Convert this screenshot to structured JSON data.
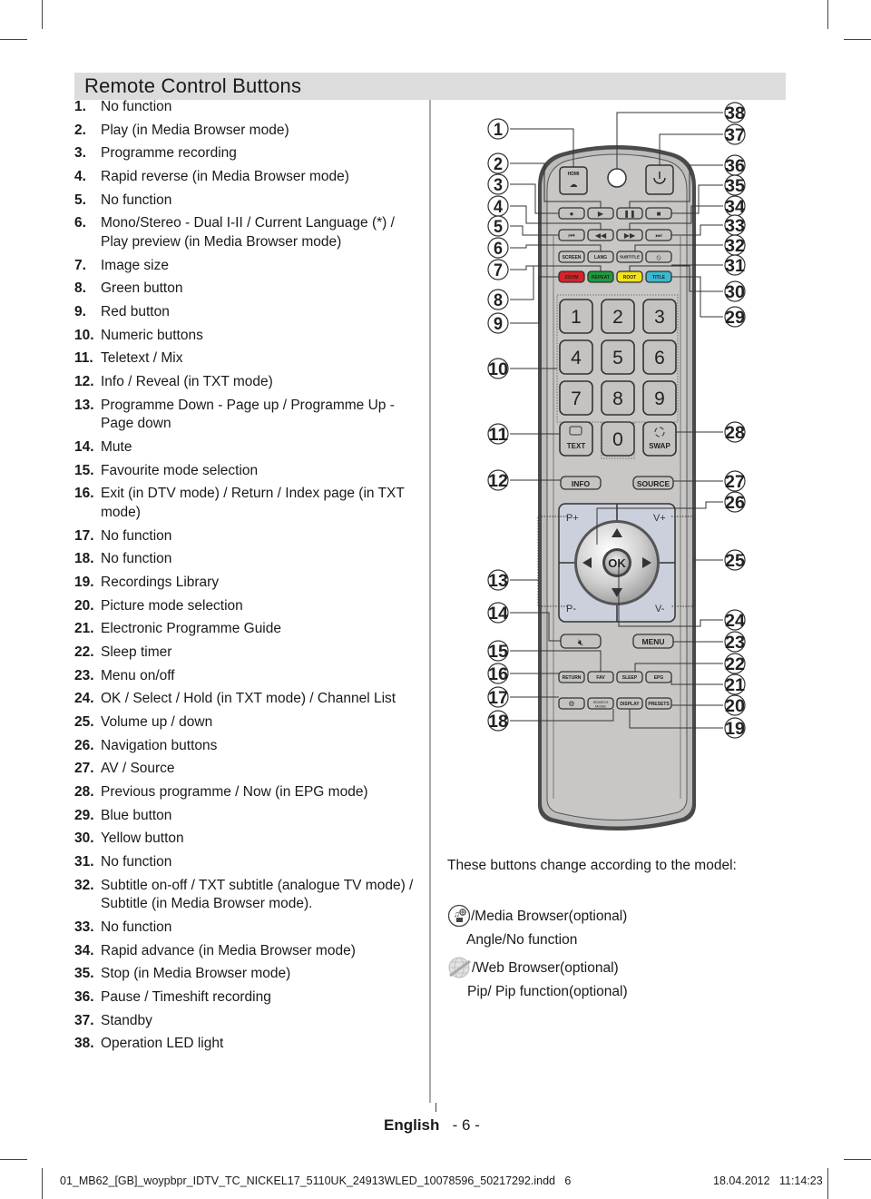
{
  "page": {
    "title": "Remote Control Buttons",
    "items": [
      {
        "num": "1.",
        "text": "No function"
      },
      {
        "num": "2.",
        "text": "Play (in Media Browser mode)"
      },
      {
        "num": "3.",
        "text": "Programme recording"
      },
      {
        "num": "4.",
        "text": "Rapid reverse (in Media Browser mode)"
      },
      {
        "num": "5.",
        "text": "No function"
      },
      {
        "num": "6.",
        "text": "Mono/Stereo - Dual I-II / Current Language (*) / Play preview (in Media Browser mode)"
      },
      {
        "num": "7.",
        "text": "Image size"
      },
      {
        "num": "8.",
        "text": "Green button"
      },
      {
        "num": "9.",
        "text": "Red button"
      },
      {
        "num": "10.",
        "text": "Numeric buttons"
      },
      {
        "num": "11.",
        "text": "Teletext / Mix"
      },
      {
        "num": "12.",
        "text": "Info / Reveal (in TXT mode)"
      },
      {
        "num": "13.",
        "text": "Programme Down - Page up / Programme Up - Page down"
      },
      {
        "num": "14.",
        "text": "Mute"
      },
      {
        "num": "15.",
        "text": "Favourite mode selection"
      },
      {
        "num": "16.",
        "text": "Exit (in DTV mode) / Return / Index page (in TXT mode)"
      },
      {
        "num": "17.",
        "text": "No function"
      },
      {
        "num": "18.",
        "text": "No function"
      },
      {
        "num": "19.",
        "text": "Recordings Library"
      },
      {
        "num": "20.",
        "text": "Picture mode selection"
      },
      {
        "num": "21.",
        "text": "Electronic Programme Guide"
      },
      {
        "num": "22.",
        "text": "Sleep timer"
      },
      {
        "num": "23.",
        "text": "Menu on/off"
      },
      {
        "num": "24.",
        "text": "OK / Select / Hold (in TXT mode) / Channel List"
      },
      {
        "num": "25.",
        "text": "Volume up / down"
      },
      {
        "num": "26.",
        "text": "Navigation buttons"
      },
      {
        "num": "27.",
        "text": "AV / Source"
      },
      {
        "num": "28.",
        "text": "Previous programme / Now (in EPG mode)"
      },
      {
        "num": "29.",
        "text": "Blue button"
      },
      {
        "num": "30.",
        "text": "Yellow button"
      },
      {
        "num": "31.",
        "text": "No function"
      },
      {
        "num": "32.",
        "text": "Subtitle on-off / TXT subtitle (analogue TV mode) / Subtitle (in Media Browser mode)."
      },
      {
        "num": "33.",
        "text": "No function"
      },
      {
        "num": "34.",
        "text": "Rapid advance (in Media Browser mode)"
      },
      {
        "num": "35.",
        "text": "Stop (in Media Browser mode)"
      },
      {
        "num": "36.",
        "text": "Pause / Timeshift recording"
      },
      {
        "num": "37.",
        "text": "Standby"
      },
      {
        "num": "38.",
        "text": "Operation LED light"
      }
    ]
  },
  "remote": {
    "buttons": {
      "hdmi": "HDMI",
      "screen": "SCREEN",
      "lang": "LANG",
      "subtitle": "SUBTITLE",
      "zoom": "ZOOM",
      "repeat": "REPEAT",
      "root": "ROOT",
      "title": "TITLE",
      "digits": [
        "1",
        "2",
        "3",
        "4",
        "5",
        "6",
        "7",
        "8",
        "9",
        "0"
      ],
      "text": "TEXT",
      "swap": "SWAP",
      "info": "INFO",
      "source": "SOURCE",
      "p_plus": "P+",
      "p_minus": "P-",
      "v_plus": "V+",
      "v_minus": "V-",
      "ok": "OK",
      "menu": "MENU",
      "return": "RETURN",
      "fav": "FAV",
      "sleep": "SLEEP",
      "epg": "EPG",
      "search_mode_1": "SEARCH",
      "search_mode_2": "MODE",
      "display": "DISPLAY",
      "presets": "PRESETS"
    },
    "colors": {
      "red": "#d8232a",
      "green": "#1f9a3e",
      "yellow": "#f2e21b",
      "blue": "#3cb8cf",
      "body": "#c8c7c5",
      "nav_pad": "#ccd0dc"
    },
    "callouts_left": [
      "1",
      "2",
      "3",
      "4",
      "5",
      "6",
      "7",
      "8",
      "9",
      "10",
      "11",
      "12",
      "13",
      "14",
      "15",
      "16",
      "17",
      "18"
    ],
    "callouts_right": [
      "38",
      "37",
      "36",
      "35",
      "34",
      "33",
      "32",
      "31",
      "30",
      "29",
      "28",
      "27",
      "26",
      "25",
      "24",
      "23",
      "22",
      "21",
      "20",
      "19"
    ]
  },
  "notes": {
    "heading": "These buttons change according to the model:",
    "media_browser": "/Media Browser(optional)",
    "angle": "Angle/No function",
    "web_browser": "/Web Browser(optional)",
    "pip": "Pip/ Pip function(optional)"
  },
  "footer": {
    "language": "English",
    "page_number": "- 6 -",
    "file_slug": "01_MB62_[GB]_woypbpr_IDTV_TC_NICKEL17_5110UK_24913WLED_10078596_50217292.indd   6",
    "timestamp": "18.04.2012   11:14:23"
  }
}
